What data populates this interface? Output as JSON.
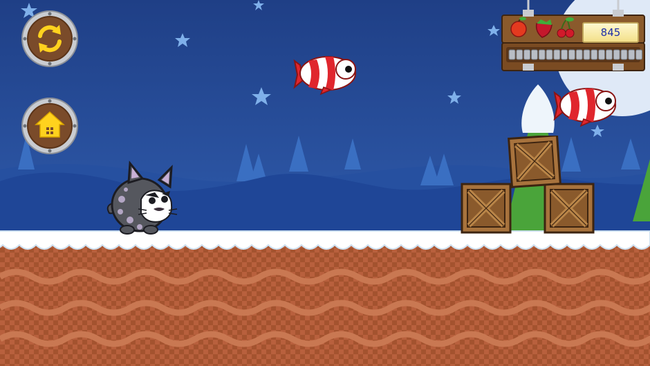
{
  "hud": {
    "score": "845",
    "fruits": [
      {
        "name": "apple-icon"
      },
      {
        "name": "strawberry-icon"
      },
      {
        "name": "cherry-icon"
      }
    ],
    "energy_segments": 18
  },
  "buttons": {
    "restart": {
      "icon": "restart-icon"
    },
    "home": {
      "icon": "home-icon"
    }
  },
  "colors": {
    "sky": "#2c56a5",
    "ground": "#b8603d",
    "snow": "#ffffff",
    "button_face": "#7a4b2a",
    "icon_yellow": "#ffd21e",
    "fish_red": "#e0262d"
  }
}
